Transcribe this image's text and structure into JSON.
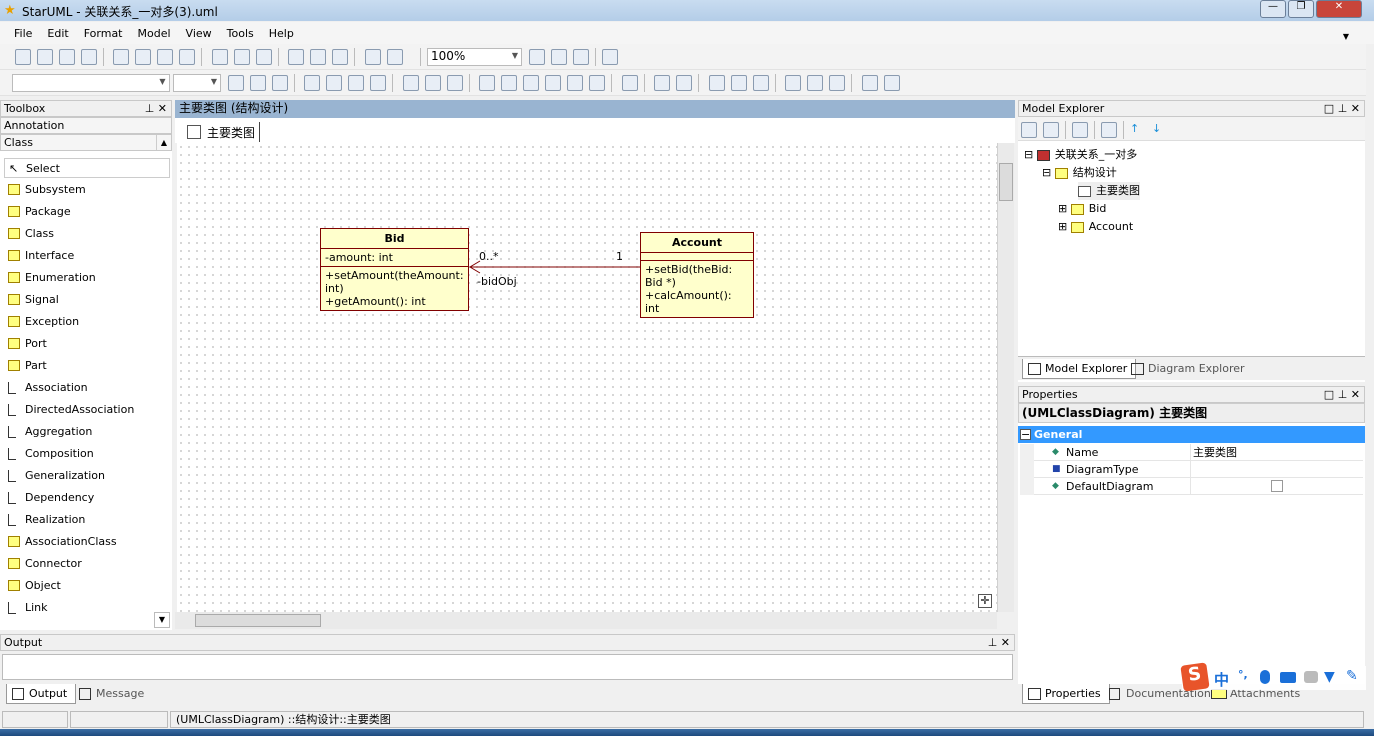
{
  "window": {
    "title": "StarUML - 关联关系_一对多(3).uml"
  },
  "menu": [
    "File",
    "Edit",
    "Format",
    "Model",
    "View",
    "Tools",
    "Help"
  ],
  "toolbar": {
    "zoom": "100%"
  },
  "toolbox": {
    "title": "Toolbox",
    "sections": [
      "Annotation",
      "Class"
    ],
    "items": [
      "Select",
      "Subsystem",
      "Package",
      "Class",
      "Interface",
      "Enumeration",
      "Signal",
      "Exception",
      "Port",
      "Part",
      "Association",
      "DirectedAssociation",
      "Aggregation",
      "Composition",
      "Generalization",
      "Dependency",
      "Realization",
      "AssociationClass",
      "Connector",
      "Object",
      "Link"
    ]
  },
  "diagram": {
    "header": "主要类图 (结构设计)",
    "tab": "主要类图",
    "classes": [
      {
        "name": "Bid",
        "attributes": [
          "-amount: int"
        ],
        "operations": [
          "+setAmount(theAmount: int)",
          "+getAmount(): int"
        ]
      },
      {
        "name": "Account",
        "attributes": [],
        "operations": [
          "+setBid(theBid: Bid *)",
          "+calcAmount(): int"
        ]
      }
    ],
    "association": {
      "target_multiplicity": "0..*",
      "source_multiplicity": "1",
      "role": "-bidObj",
      "color": "#800000"
    }
  },
  "explorer": {
    "title": "Model Explorer",
    "tree": [
      "关联关系_一对多",
      "结构设计",
      "主要类图",
      "Bid",
      "Account"
    ],
    "tabs": [
      "Model Explorer",
      "Diagram Explorer"
    ]
  },
  "properties": {
    "title": "Properties",
    "heading": "(UMLClassDiagram) 主要类图",
    "group": "General",
    "rows": [
      {
        "name": "Name",
        "value": "主要类图"
      },
      {
        "name": "DiagramType",
        "value": ""
      },
      {
        "name": "DefaultDiagram",
        "value": ""
      }
    ],
    "tabs": [
      "Properties",
      "Documentation",
      "Attachments"
    ]
  },
  "output": {
    "title": "Output",
    "tabs": [
      "Output",
      "Message"
    ]
  },
  "status": {
    "text": "(UMLClassDiagram) ::结构设计::主要类图"
  },
  "ime": {
    "label": "中"
  }
}
